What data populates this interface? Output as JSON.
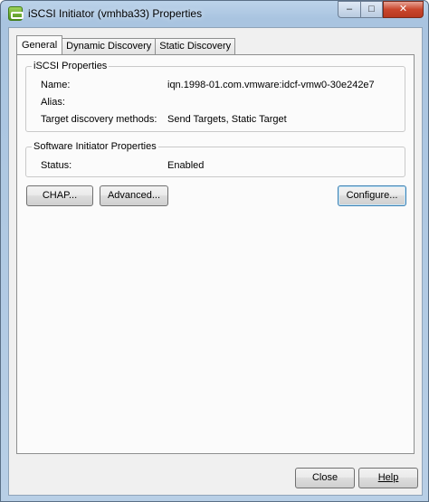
{
  "window": {
    "title": "iSCSI Initiator (vmhba33) Properties",
    "caption_buttons": {
      "minimize": "–",
      "maximize": "□",
      "close": "✕"
    }
  },
  "tabs": [
    {
      "label": "General",
      "active": true
    },
    {
      "label": "Dynamic Discovery",
      "active": false
    },
    {
      "label": "Static Discovery",
      "active": false
    }
  ],
  "iscsi_properties": {
    "title": "iSCSI Properties",
    "rows": [
      {
        "label": "Name:",
        "value": "iqn.1998-01.com.vmware:idcf-vmw0-30e242e7"
      },
      {
        "label": "Alias:",
        "value": ""
      },
      {
        "label": "Target discovery methods:",
        "value": "Send Targets, Static Target"
      }
    ]
  },
  "software_initiator": {
    "title": "Software Initiator Properties",
    "rows": [
      {
        "label": "Status:",
        "value": "Enabled"
      }
    ]
  },
  "buttons": {
    "chap": "CHAP...",
    "advanced": "Advanced...",
    "configure": "Configure...",
    "close": "Close",
    "help": "Help"
  },
  "colors": {
    "titlebar": "#a9c4e0",
    "client_bg": "#f0f0f0",
    "close_button": "#c9462c"
  },
  "icons": {
    "app": "vmware-iscsi-icon"
  }
}
